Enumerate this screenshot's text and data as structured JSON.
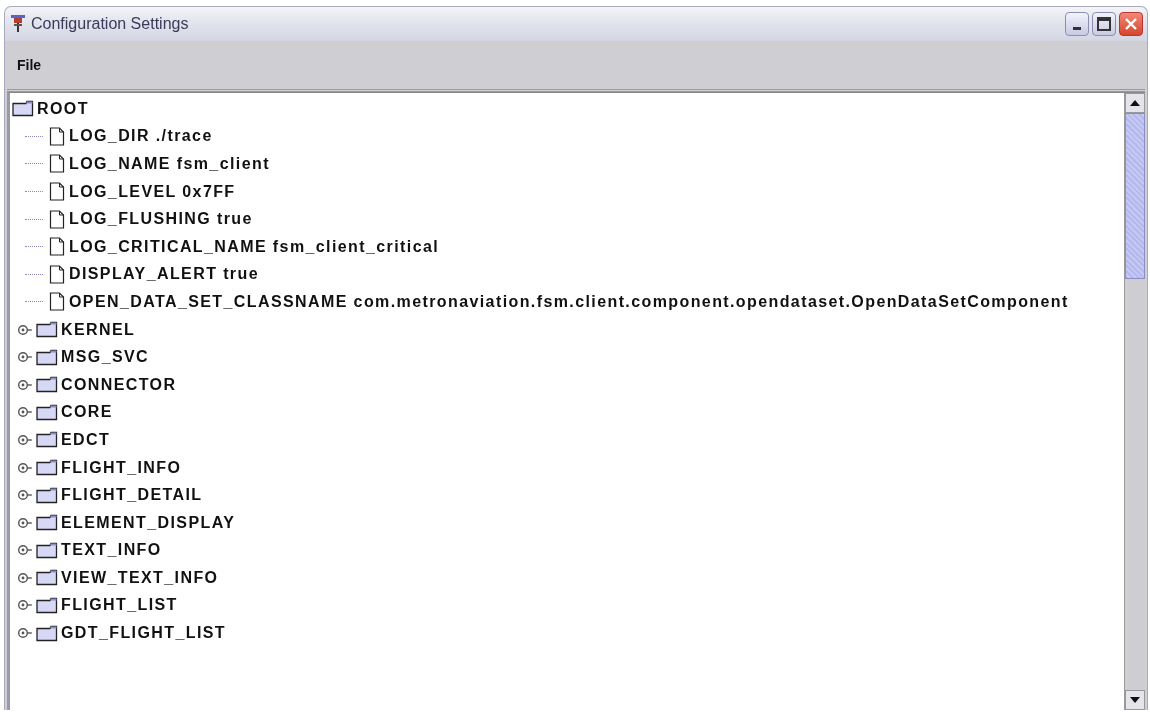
{
  "window": {
    "title": "Configuration Settings"
  },
  "menu": [
    {
      "label": "File"
    }
  ],
  "tree": {
    "label": "ROOT",
    "children": [
      {
        "kind": "leaf",
        "label": "LOG_DIR ./trace"
      },
      {
        "kind": "leaf",
        "label": "LOG_NAME fsm_client"
      },
      {
        "kind": "leaf",
        "label": "LOG_LEVEL 0x7FF"
      },
      {
        "kind": "leaf",
        "label": "LOG_FLUSHING true"
      },
      {
        "kind": "leaf",
        "label": "LOG_CRITICAL_NAME fsm_client_critical"
      },
      {
        "kind": "leaf",
        "label": "DISPLAY_ALERT true"
      },
      {
        "kind": "leaf",
        "label": "OPEN_DATA_SET_CLASSNAME com.metronaviation.fsm.client.component.opendataset.OpenDataSetComponent"
      },
      {
        "kind": "folder",
        "label": "KERNEL",
        "expanded": false
      },
      {
        "kind": "folder",
        "label": "MSG_SVC",
        "expanded": false
      },
      {
        "kind": "folder",
        "label": "CONNECTOR",
        "expanded": false
      },
      {
        "kind": "folder",
        "label": "CORE",
        "expanded": false
      },
      {
        "kind": "folder",
        "label": "EDCT",
        "expanded": false
      },
      {
        "kind": "folder",
        "label": "FLIGHT_INFO",
        "expanded": false
      },
      {
        "kind": "folder",
        "label": "FLIGHT_DETAIL",
        "expanded": false
      },
      {
        "kind": "folder",
        "label": "ELEMENT_DISPLAY",
        "expanded": false
      },
      {
        "kind": "folder",
        "label": "TEXT_INFO",
        "expanded": false
      },
      {
        "kind": "folder",
        "label": "VIEW_TEXT_INFO",
        "expanded": false
      },
      {
        "kind": "folder",
        "label": "FLIGHT_LIST",
        "expanded": false
      },
      {
        "kind": "folder",
        "label": "GDT_FLIGHT_LIST",
        "expanded": false
      }
    ]
  }
}
